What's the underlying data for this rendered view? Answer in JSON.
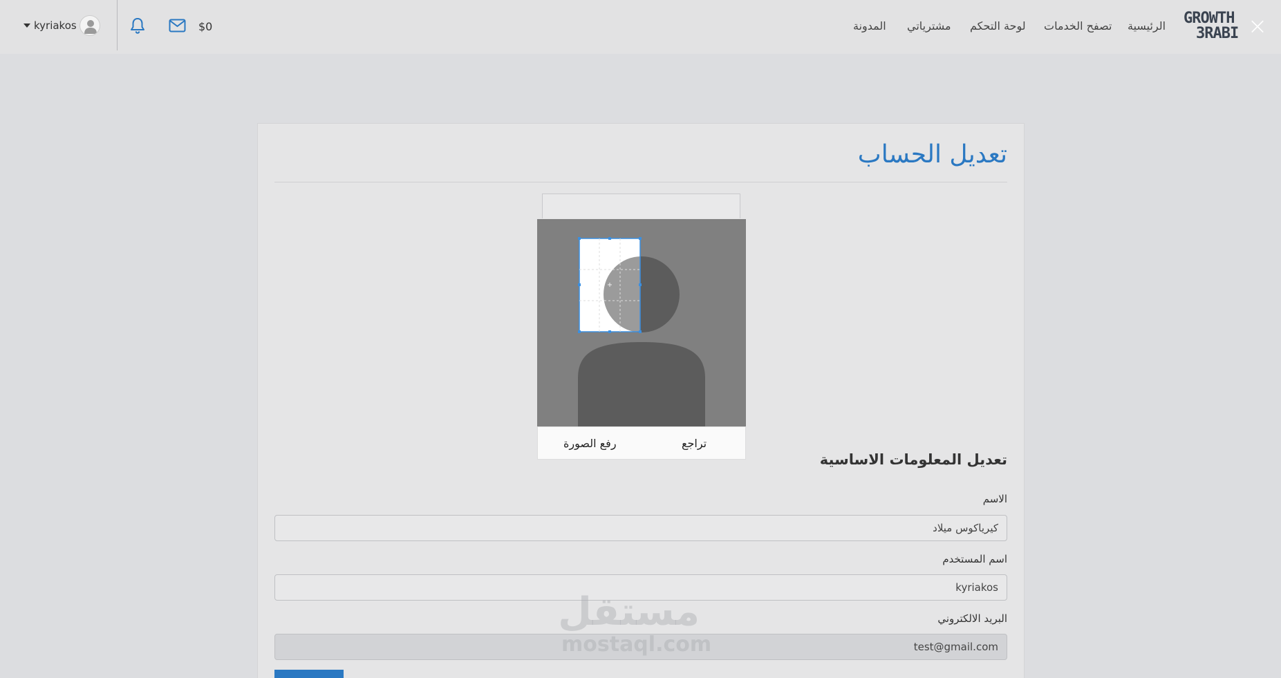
{
  "navbar": {
    "logo": {
      "line1": "GROWTH",
      "line2": "3RABI"
    },
    "links": [
      "الرئيسية",
      "تصفح الخدمات",
      "لوحة التحكم",
      "مشترياتي",
      "المدونة"
    ],
    "balance": "$0",
    "username": "kyriakos"
  },
  "page": {
    "title": "تعديل الحساب",
    "cropper": {
      "undo_label": "تراجع",
      "upload_label": "رفع الصورة"
    },
    "section_title": "تعديل المعلومات الاساسية",
    "fields": {
      "name_label": "الاسم",
      "name_value": "كيرياكوس ميلاد",
      "username_label": "اسم المستخدم",
      "username_value": "kyriakos",
      "email_label": "البريد الالكتروني",
      "email_value": "test@gmail.com"
    }
  },
  "watermark": {
    "arabic": "مستقل",
    "latin": "mostaql.com"
  },
  "colors": {
    "accent": "#2a78c2",
    "navbar_bg": "#e2e2e3",
    "page_bg": "#dcdde0"
  }
}
